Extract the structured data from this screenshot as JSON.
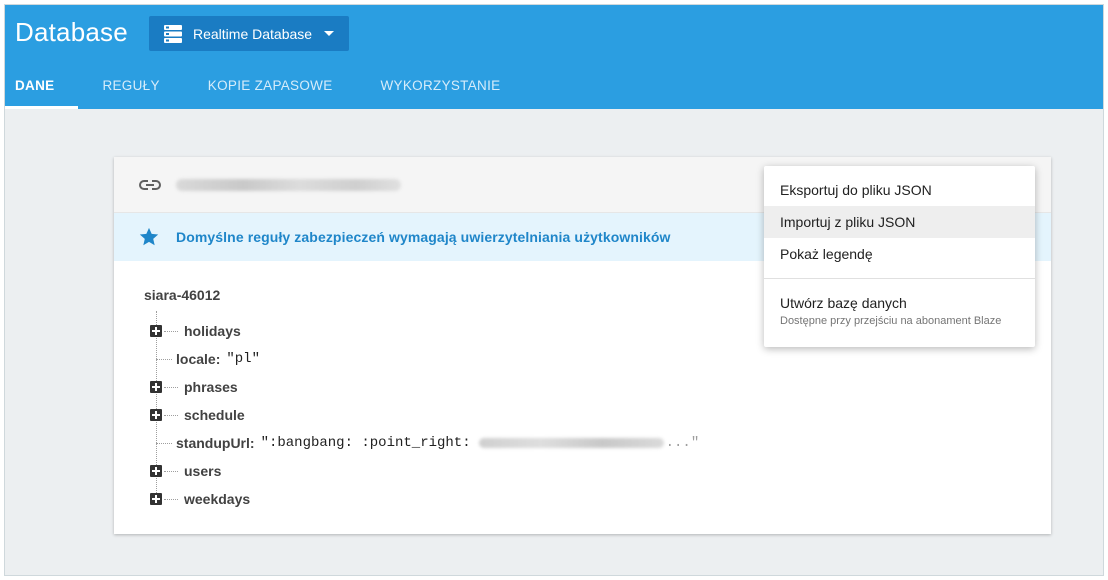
{
  "header": {
    "title": "Database",
    "db_selector": {
      "label": "Realtime Database",
      "icon": "database-icon"
    },
    "tabs": [
      {
        "label": "DANE",
        "active": true
      },
      {
        "label": "REGUŁY",
        "active": false
      },
      {
        "label": "KOPIE ZAPASOWE",
        "active": false
      },
      {
        "label": "WYKORZYSTANIE",
        "active": false
      }
    ]
  },
  "card": {
    "url_icon": "link-icon",
    "banner": {
      "icon": "star-icon",
      "text": "Domyślne reguły zabezpieczeń wymagają uwierzytelniania użytkowników"
    },
    "tree": {
      "root": "siara-46012",
      "nodes": [
        {
          "key": "holidays",
          "expandable": true
        },
        {
          "key": "locale:",
          "value": "\"pl\"",
          "expandable": false
        },
        {
          "key": "phrases",
          "expandable": true
        },
        {
          "key": "schedule",
          "expandable": true
        },
        {
          "key": "standupUrl:",
          "value": "\":bangbang: :point_right:",
          "value_tail": "...\"",
          "expandable": false
        },
        {
          "key": "users",
          "expandable": true
        },
        {
          "key": "weekdays",
          "expandable": true
        }
      ]
    }
  },
  "menu": {
    "items": [
      {
        "label": "Eksportuj do pliku JSON"
      },
      {
        "label": "Importuj z pliku JSON",
        "hovered": true
      },
      {
        "label": "Pokaż legendę"
      }
    ],
    "create": {
      "label": "Utwórz bazę danych",
      "sublabel": "Dostępne przy przejściu na abonament Blaze"
    }
  },
  "colors": {
    "header_blue": "#2b9ee1",
    "selector_blue": "#1a7cc3",
    "banner_bg": "#e4f4fd",
    "banner_text": "#1f86c9",
    "page_bg": "#eceff1"
  }
}
